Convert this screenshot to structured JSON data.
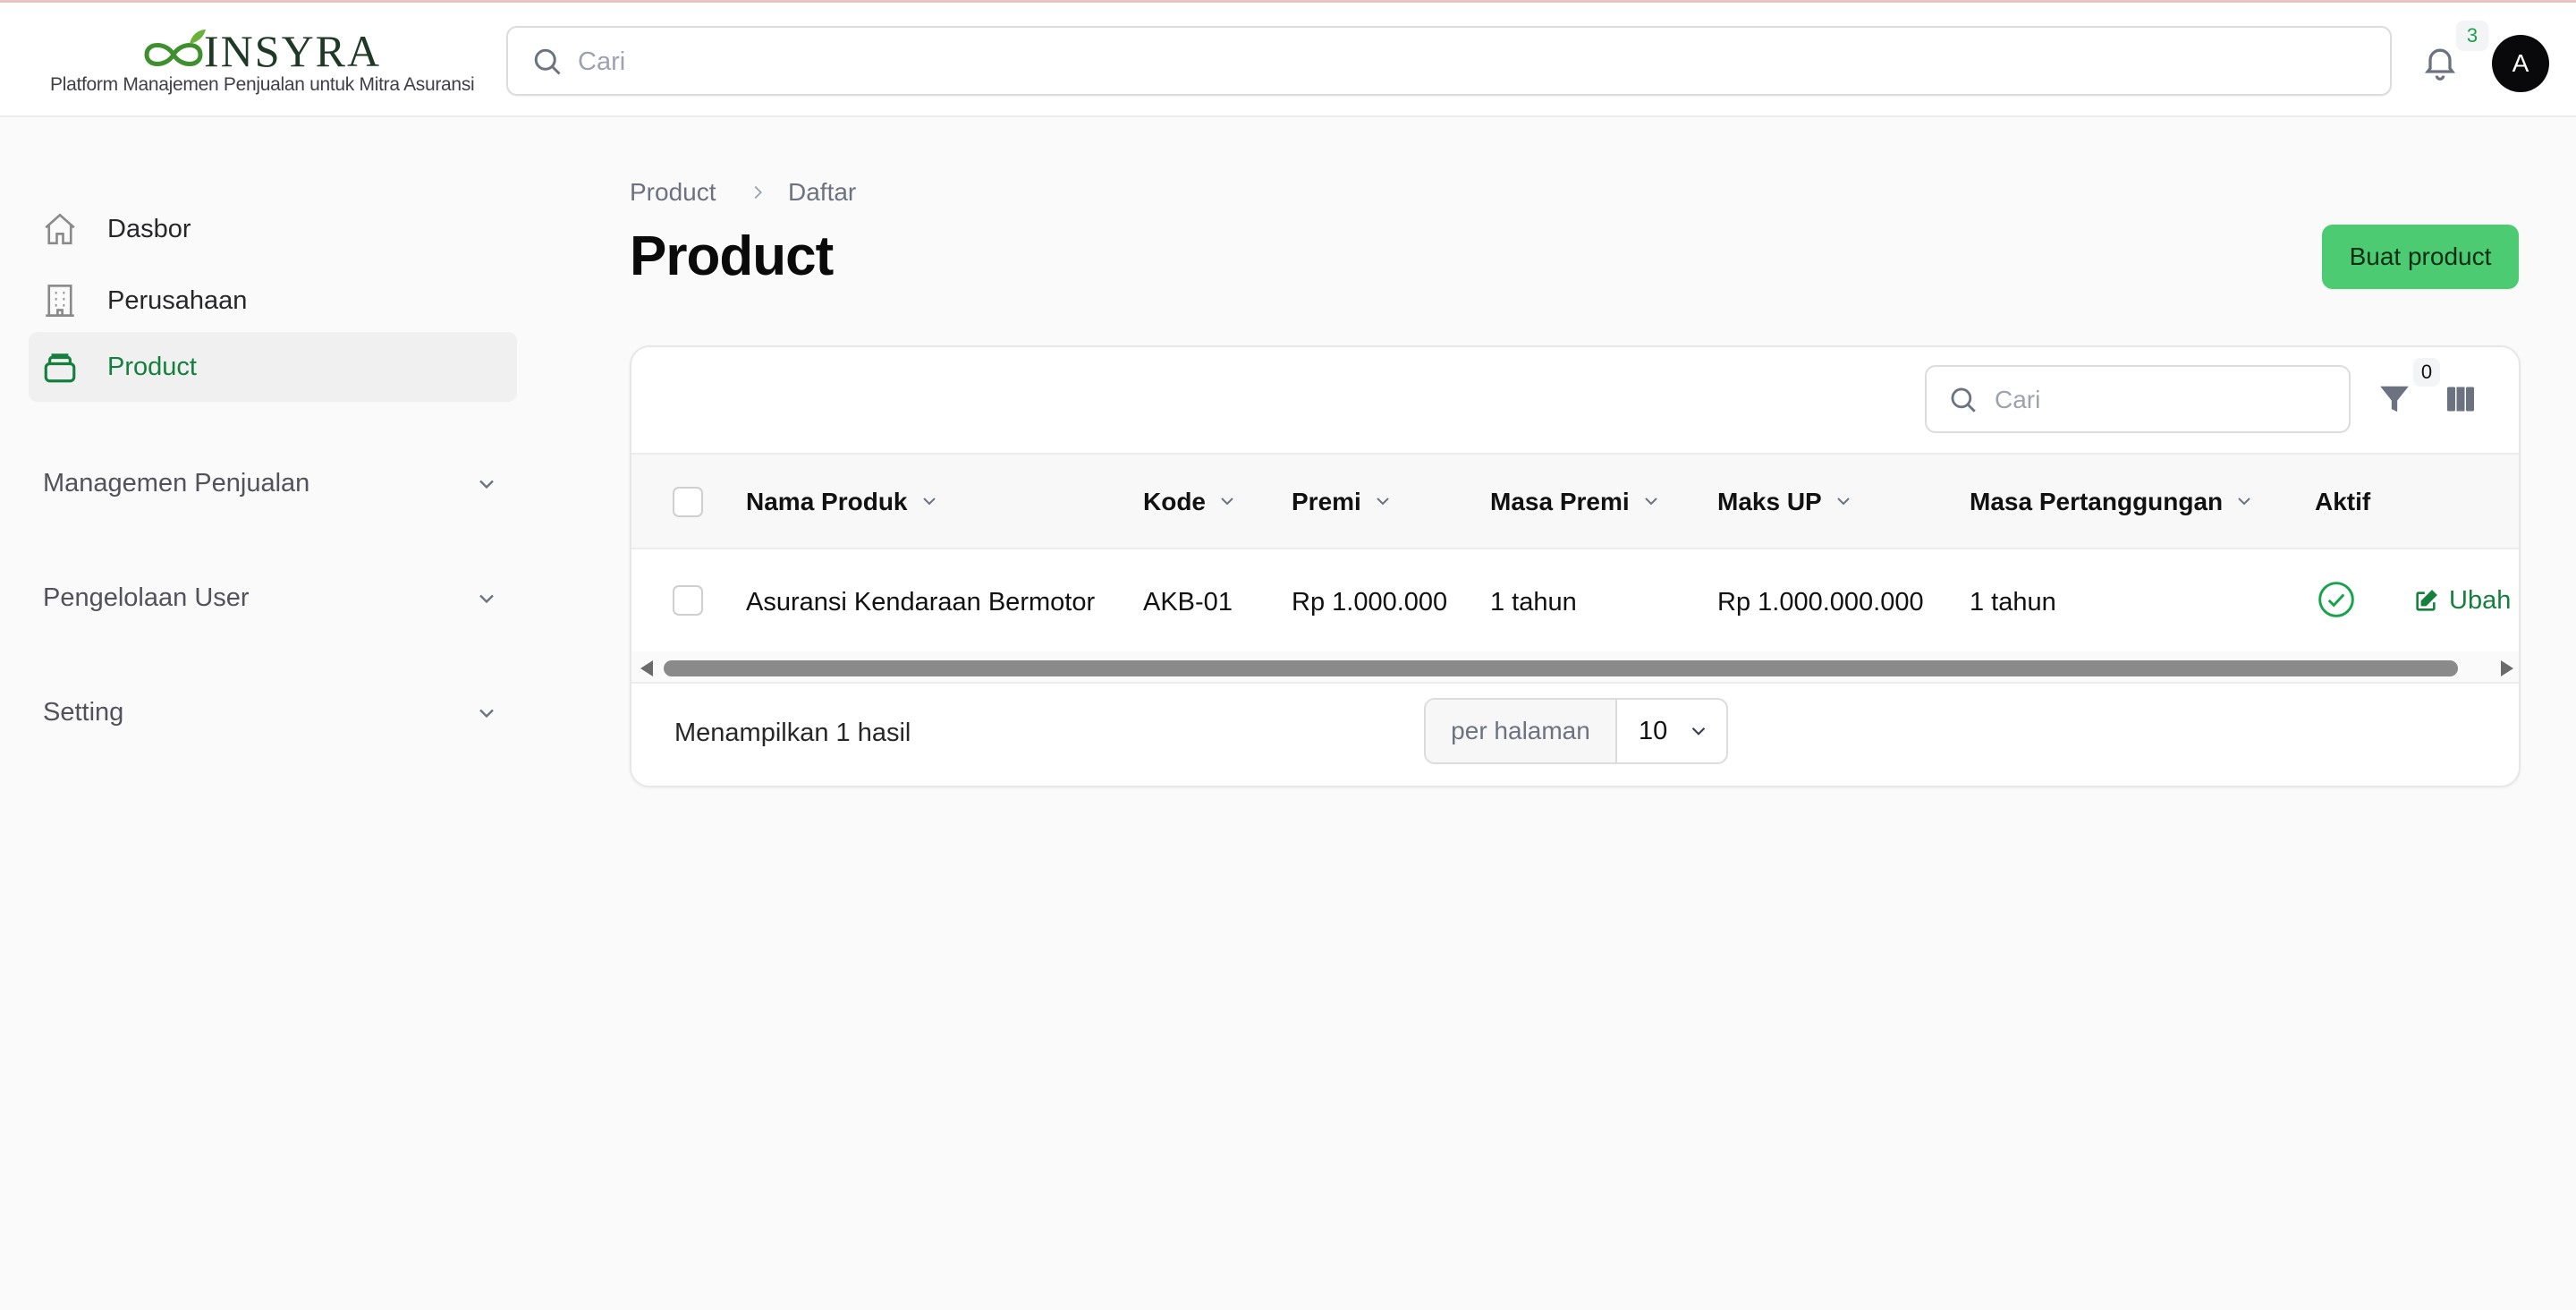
{
  "brand": {
    "name": "INSYRA",
    "tagline": "Platform Manajemen Penjualan untuk Mitra Asuransi",
    "accent": "#15803d"
  },
  "header": {
    "search_placeholder": "Cari",
    "notification_count": "3",
    "avatar_initial": "A"
  },
  "sidebar": {
    "items": [
      {
        "label": "Dasbor",
        "icon": "home-icon"
      },
      {
        "label": "Perusahaan",
        "icon": "building-icon"
      },
      {
        "label": "Product",
        "icon": "stack-icon",
        "active": true
      }
    ],
    "groups": [
      {
        "label": "Managemen Penjualan"
      },
      {
        "label": "Pengelolaan User"
      },
      {
        "label": "Setting"
      }
    ]
  },
  "breadcrumb": {
    "parent": "Product",
    "current": "Daftar"
  },
  "page": {
    "title": "Product",
    "create_button": "Buat product",
    "create_button_color": "#4ccb73"
  },
  "table": {
    "search_placeholder": "Cari",
    "filter_count": "0",
    "columns": [
      "Nama Produk",
      "Kode",
      "Premi",
      "Masa Premi",
      "Maks UP",
      "Masa Pertanggungan",
      "Aktif"
    ],
    "rows": [
      {
        "nama_produk": "Asuransi Kendaraan Bermotor",
        "kode": "AKB-01",
        "premi": "Rp 1.000.000",
        "masa_premi": "1 tahun",
        "maks_up": "Rp 1.000.000.000",
        "masa_pertanggungan": "1 tahun",
        "aktif": true,
        "action": "Ubah"
      }
    ],
    "footer": {
      "results_text": "Menampilkan 1 hasil",
      "per_page_label": "per halaman",
      "per_page_value": "10"
    }
  }
}
